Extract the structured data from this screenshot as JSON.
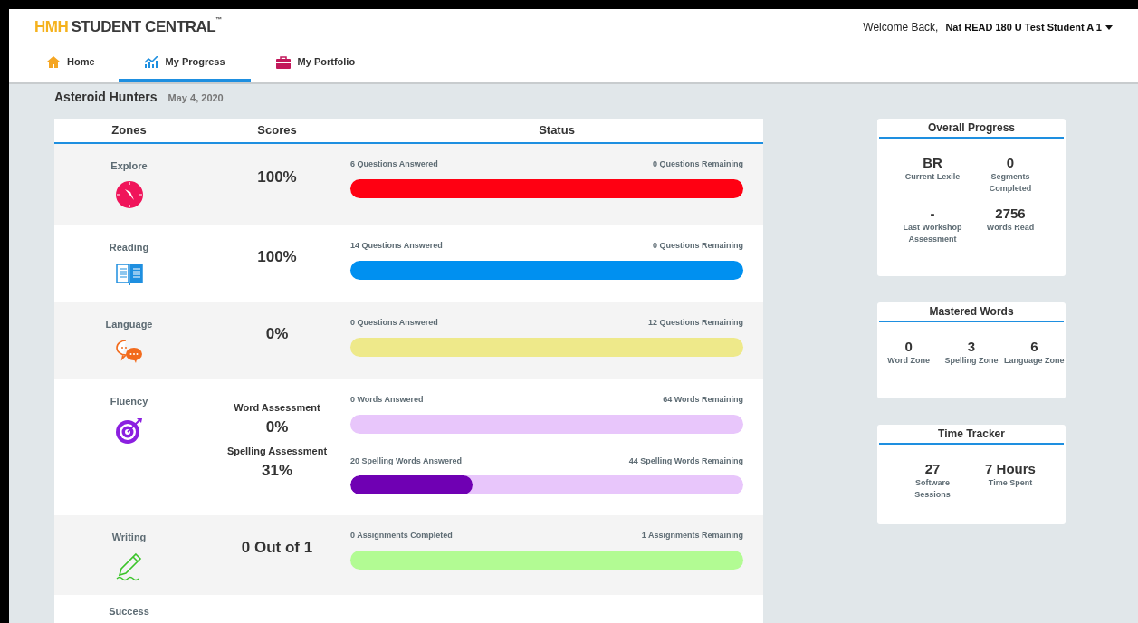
{
  "header": {
    "logo_brand": "HMH",
    "logo_text": "STUDENT CENTRAL",
    "logo_mark": "™",
    "welcome": "Welcome Back,",
    "user": "Nat READ 180 U Test Student A 1"
  },
  "tabs": [
    {
      "label": "Home",
      "selected": false
    },
    {
      "label": "My Progress",
      "selected": true
    },
    {
      "label": "My Portfolio",
      "selected": false
    }
  ],
  "program": {
    "title": "Asteroid Hunters",
    "date": "May 4, 2020"
  },
  "table": {
    "columns": [
      "Zones",
      "Scores",
      "Status"
    ],
    "rows": [
      {
        "zone": "Explore",
        "scores": [
          {
            "value": "100%"
          }
        ],
        "bars": [
          {
            "left": "6 Questions Answered",
            "right": "0 Questions Remaining",
            "color": "#ff0012"
          }
        ]
      },
      {
        "zone": "Reading",
        "scores": [
          {
            "value": "100%"
          }
        ],
        "bars": [
          {
            "left": "14 Questions Answered",
            "right": "0 Questions Remaining",
            "color": "#0090f0"
          }
        ]
      },
      {
        "zone": "Language",
        "scores": [
          {
            "value": "0%"
          }
        ],
        "bars": [
          {
            "left": "0 Questions Answered",
            "right": "12 Questions Remaining",
            "color": "#eee98a"
          }
        ]
      },
      {
        "zone": "Fluency",
        "scores": [
          {
            "label": "Word Assessment",
            "value": "0%"
          },
          {
            "label": "Spelling Assessment",
            "value": "31%"
          }
        ],
        "bars": [
          {
            "left": "0 Words Answered",
            "right": "64 Words Remaining",
            "color": "#e8c6fb"
          },
          {
            "left": "20 Spelling Words Answered",
            "right": "44 Spelling Words Remaining",
            "level": 0.31,
            "color": "#6f00b3"
          }
        ]
      },
      {
        "zone": "Writing",
        "scores": [
          {
            "value": "0 Out of 1"
          }
        ],
        "bars": [
          {
            "left": "0 Assignments Completed",
            "right": "1 Assignments Remaining",
            "color": "#b2fb93"
          }
        ]
      },
      {
        "zone": "Success",
        "scores": [],
        "bars": []
      }
    ]
  },
  "cards": [
    {
      "title": "Overall Progress",
      "stats": [
        {
          "value": "BR",
          "label": "Current Lexile"
        },
        {
          "value": "0",
          "label": "Segments Completed"
        },
        {
          "value": "-",
          "label": "Last Workshop Assessment"
        },
        {
          "value": "2756",
          "label": "Words Read"
        }
      ]
    },
    {
      "title": "Mastered Words",
      "stats": [
        {
          "value": "0",
          "label": "Word Zone"
        },
        {
          "value": "3",
          "label": "Spelling Zone"
        },
        {
          "value": "6",
          "label": "Language Zone"
        }
      ]
    },
    {
      "title": "Time Tracker",
      "stats": [
        {
          "value": "27",
          "label": "Software Sessions"
        },
        {
          "value": "7 Hours",
          "label": "Time Spent"
        }
      ]
    }
  ]
}
